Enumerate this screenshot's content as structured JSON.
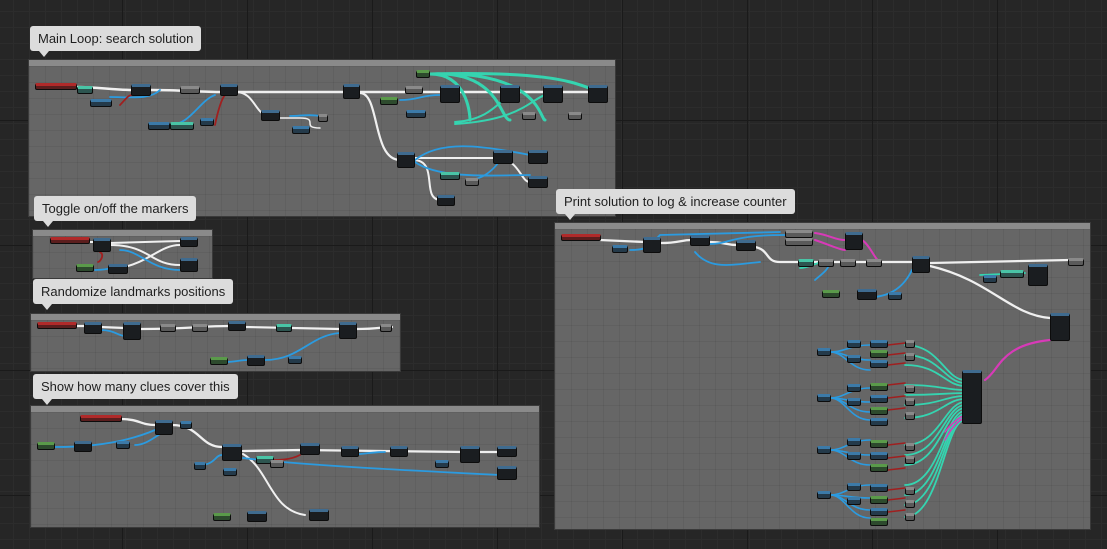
{
  "comments": [
    {
      "id": "main-loop",
      "title": "Main Loop: search solution"
    },
    {
      "id": "toggle-markers",
      "title": "Toggle on/off the markers"
    },
    {
      "id": "randomize-landmarks",
      "title": "Randomize landmarks positions"
    },
    {
      "id": "show-clues",
      "title": "Show how many clues cover this"
    },
    {
      "id": "print-solution",
      "title": "Print solution to log & increase counter"
    }
  ],
  "colors": {
    "exec_wire": "#f0f0f0",
    "object_wire": "#2b9be0",
    "struct_wire": "#35d4b0",
    "bool_wire": "#a01f1f",
    "string_wire": "#d83ab8",
    "canvas": "#262626",
    "comment_box": "#666666"
  }
}
